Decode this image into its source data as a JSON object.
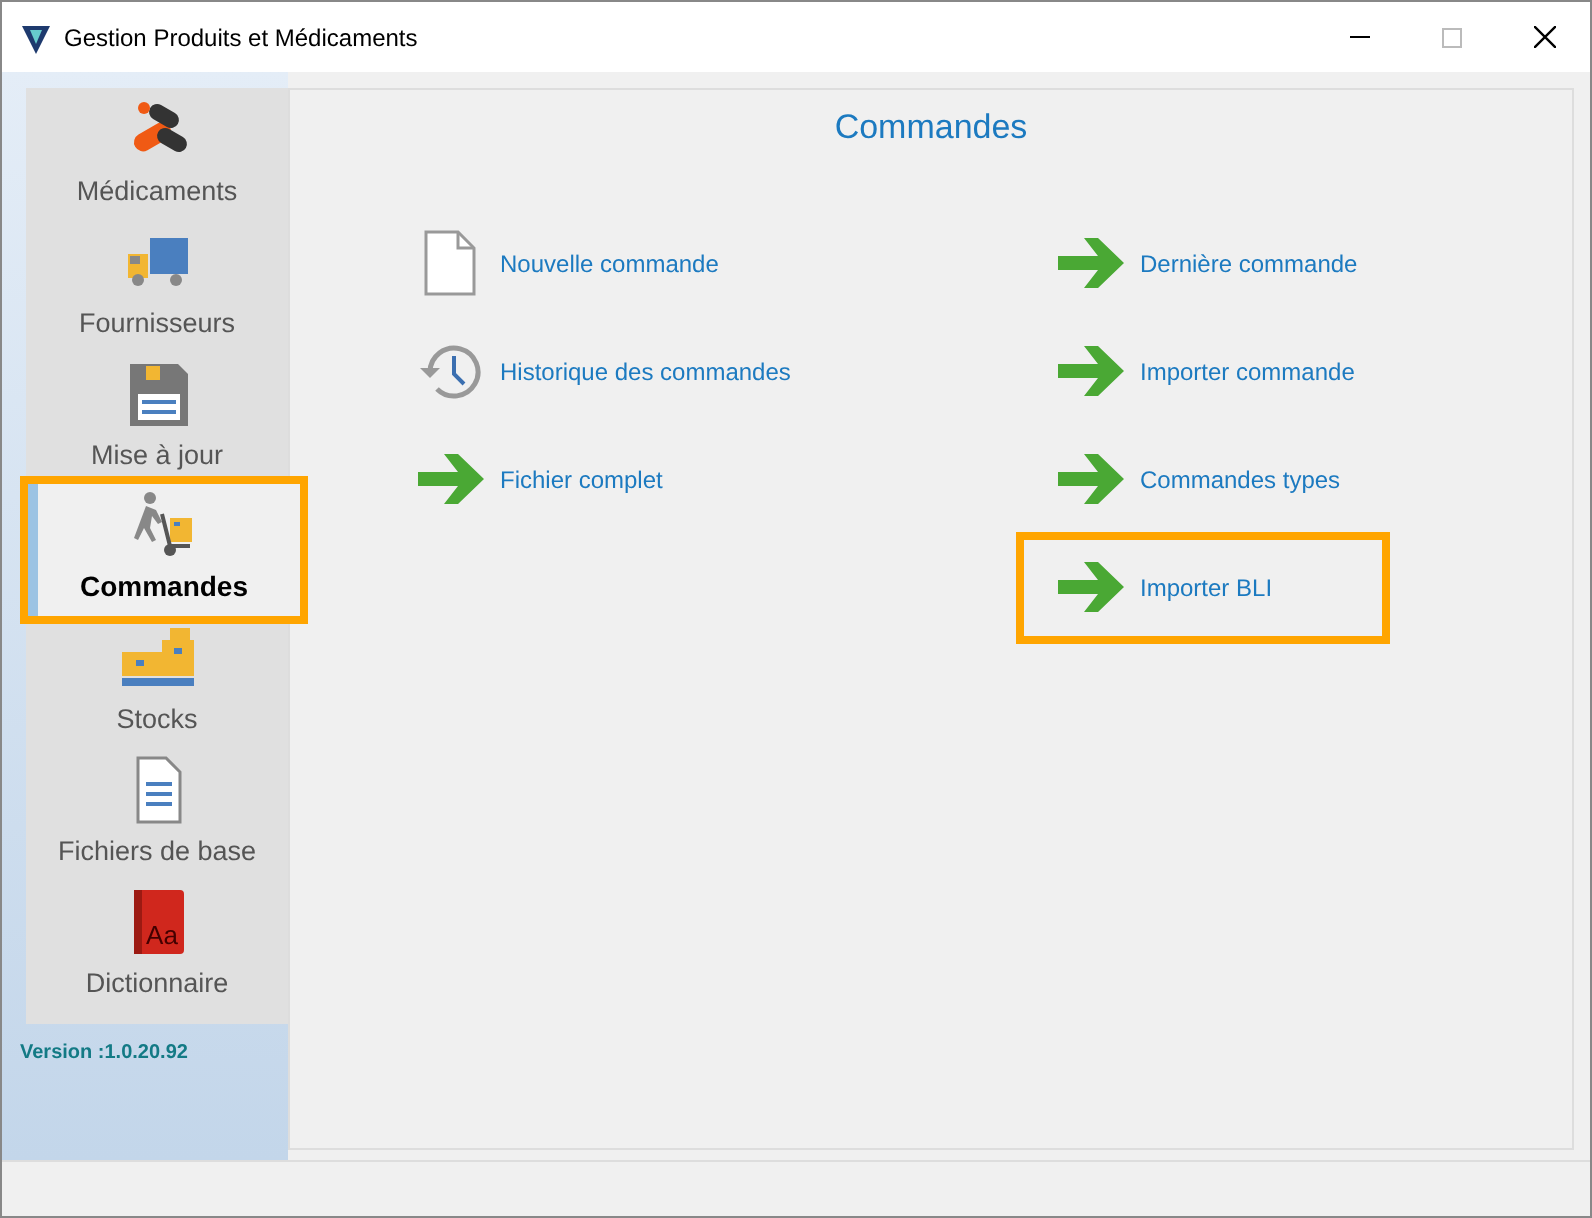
{
  "window": {
    "title": "Gestion Produits et Médicaments"
  },
  "sidebar": {
    "items": [
      {
        "label": "Médicaments",
        "kind": "pills",
        "selected": false,
        "highlighted": false
      },
      {
        "label": "Fournisseurs",
        "kind": "truck",
        "selected": false,
        "highlighted": false
      },
      {
        "label": "Mise à jour",
        "kind": "disk",
        "selected": false,
        "highlighted": false
      },
      {
        "label": "Commandes",
        "kind": "cart",
        "selected": true,
        "highlighted": true
      },
      {
        "label": "Stocks",
        "kind": "boxes",
        "selected": false,
        "highlighted": false
      },
      {
        "label": "Fichiers de base",
        "kind": "file",
        "selected": false,
        "highlighted": false
      },
      {
        "label": "Dictionnaire",
        "kind": "book",
        "icon_text": "Aa",
        "selected": false,
        "highlighted": false
      }
    ],
    "version": "Version :1.0.20.92"
  },
  "main": {
    "title": "Commandes",
    "columns": [
      [
        {
          "label": "Nouvelle commande",
          "kind": "document",
          "highlighted": false
        },
        {
          "label": "Historique des commandes",
          "kind": "history",
          "highlighted": false
        },
        {
          "label": "Fichier complet",
          "kind": "arrow",
          "highlighted": false
        }
      ],
      [
        {
          "label": "Dernière commande",
          "kind": "arrow",
          "highlighted": false
        },
        {
          "label": "Importer commande",
          "kind": "arrow",
          "highlighted": false
        },
        {
          "label": "Commandes types",
          "kind": "arrow",
          "highlighted": false
        },
        {
          "label": "Importer BLI",
          "kind": "arrow",
          "highlighted": true
        }
      ]
    ]
  }
}
